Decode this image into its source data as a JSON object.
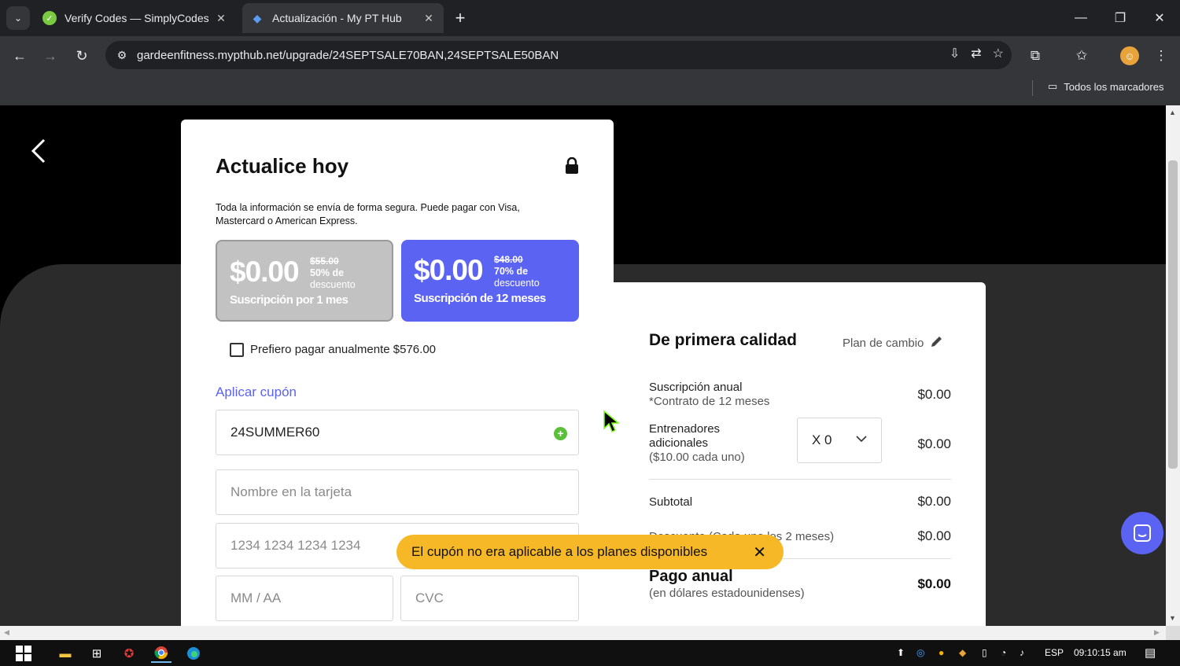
{
  "browser": {
    "tabs": [
      {
        "title": "Verify Codes — SimplyCodes",
        "active": false,
        "icon": "simplycodes-icon"
      },
      {
        "title": "Actualización - My PT Hub",
        "active": true,
        "icon": "mypthub-icon"
      }
    ],
    "url": "gardeenfitness.mypthub.net/upgrade/24SEPTSALE70BAN,24SEPTSALE50BAN",
    "bookmarks_all": "Todos los marcadores"
  },
  "checkout": {
    "title": "Actualice hoy",
    "secure_text": "Toda la información se envía de forma segura. Puede pagar con Visa, Mastercard o American Express.",
    "plans": [
      {
        "price": "$0.00",
        "original": "$55.00",
        "discount": "50% de",
        "discount_sub": "descuento",
        "label": "Suscripción por 1 mes",
        "selected": false
      },
      {
        "price": "$0.00",
        "original": "$48.00",
        "discount": "70% de",
        "discount_sub": "descuento",
        "label": "Suscripción de 12 meses",
        "selected": true
      }
    ],
    "annual_option": "Prefiero pagar anualmente $576.00",
    "apply_coupon": "Aplicar cupón",
    "coupon_value": "24SUMMER60",
    "name_placeholder": "Nombre en la tarjeta",
    "card_placeholder": "1234 1234 1234 1234",
    "expiry_placeholder": "MM / AA",
    "cvc_placeholder": "CVC"
  },
  "summary": {
    "title": "De primera calidad",
    "change_plan": "Plan de cambio",
    "annual_sub_label": "Suscripción anual",
    "annual_sub_note": "*Contrato de 12 meses",
    "annual_sub_amount": "$0.00",
    "trainers_label": "Entrenadores adicionales",
    "trainers_note": "($10.00 cada uno)",
    "trainers_qty": "X 0",
    "trainers_amount": "$0.00",
    "subtotal_label": "Subtotal",
    "subtotal_amount": "$0.00",
    "discount_label": "Descuento (Cada uno los 2 meses)",
    "discount_amount": "$0.00",
    "pay_label": "Pago anual",
    "pay_sub": "(en dólares estadounidenses)",
    "pay_amount": "$0.00"
  },
  "toast": {
    "message": "El cupón no era aplicable a los planes disponibles"
  },
  "taskbar": {
    "lang": "ESP",
    "time": "09:10:15 am"
  },
  "colors": {
    "accent": "#5b63f3",
    "toast": "#f6b826",
    "success": "#5bbf3a"
  }
}
